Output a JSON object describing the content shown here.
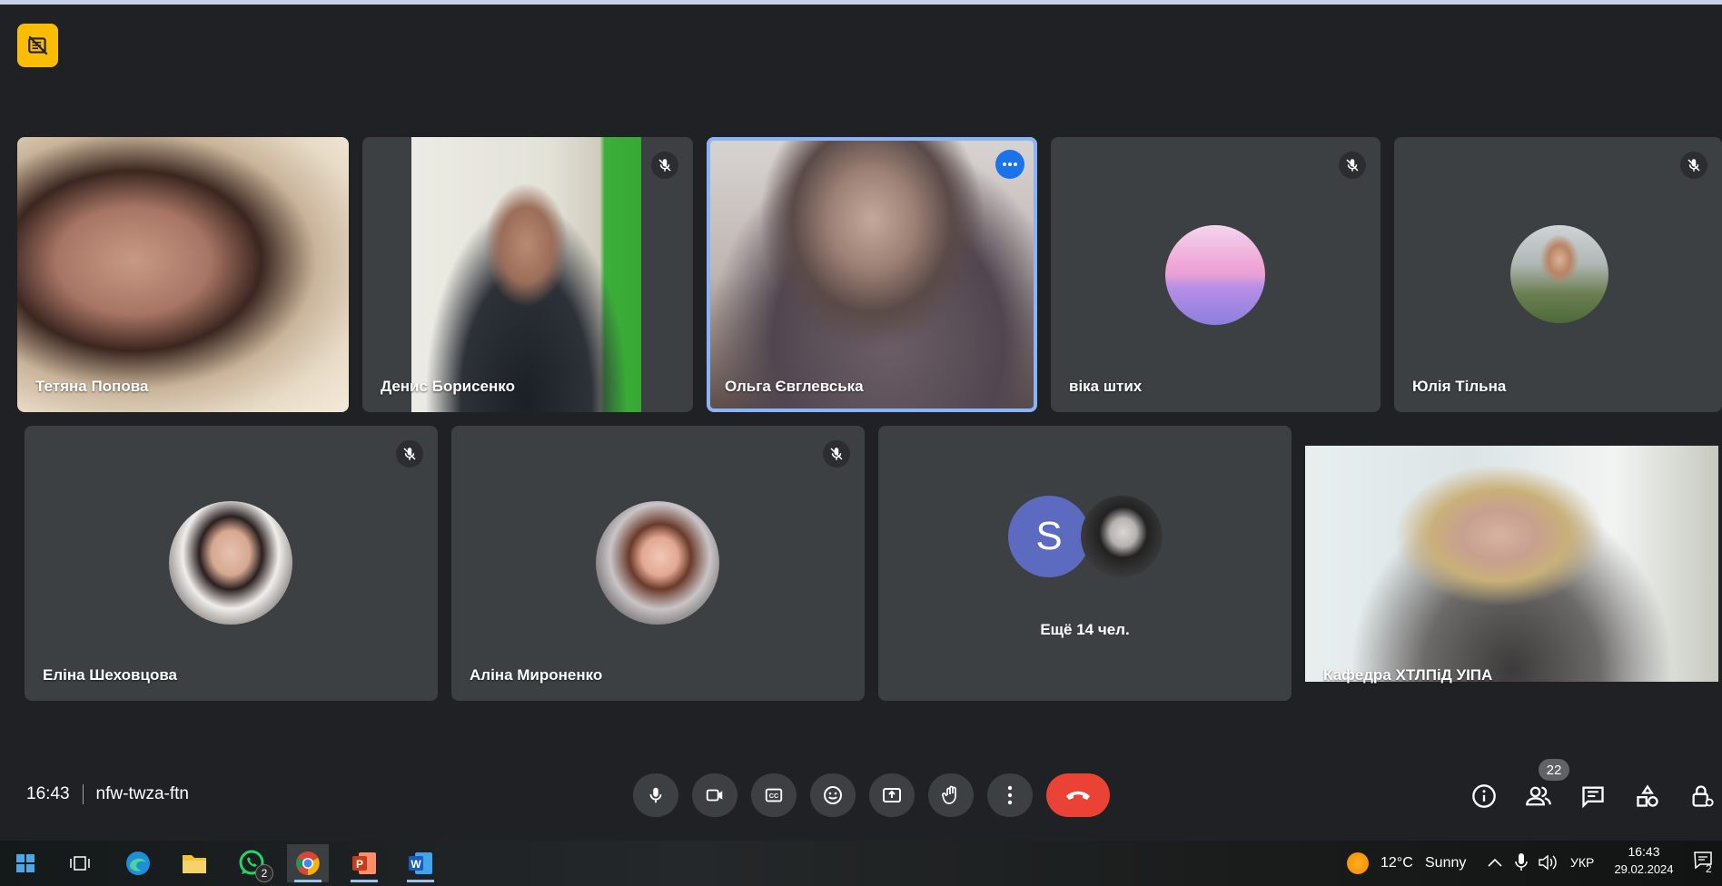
{
  "participants_row1": [
    {
      "name": "Тетяна Попова",
      "muted": false
    },
    {
      "name": "Денис Борисенко",
      "muted": true
    },
    {
      "name": "Ольга Євглевська",
      "muted": false,
      "speaking": true
    },
    {
      "name": "віка штих",
      "muted": true
    },
    {
      "name": "Юлія Тільна",
      "muted": true
    }
  ],
  "participants_row2": [
    {
      "name": "Еліна Шеховцова",
      "muted": true
    },
    {
      "name": "Аліна Мироненко",
      "muted": true
    },
    {
      "more_label": "Ещё 14 чел.",
      "avatar_letter": "S"
    },
    {
      "name": "Кафедра ХТЛПіД УІПА",
      "muted": false
    }
  ],
  "meeting": {
    "time": "16:43",
    "code": "nfw-twza-ftn"
  },
  "participants_count": "22",
  "controls": [
    "microphone-icon",
    "camera-icon",
    "captions-icon",
    "emoji-icon",
    "present-icon",
    "raise-hand-icon",
    "more-options-icon",
    "end-call-icon"
  ],
  "right_controls": [
    "info-icon",
    "people-icon",
    "chat-icon",
    "activities-icon",
    "host-controls-icon"
  ],
  "taskbar": {
    "apps": [
      "start-icon",
      "task-view-icon",
      "edge-icon",
      "file-explorer-icon",
      "whatsapp-icon",
      "chrome-icon",
      "powerpoint-icon",
      "word-icon"
    ],
    "whatsapp_badge": "2",
    "weather_temp": "12°C",
    "weather_text": "Sunny",
    "language": "УКР",
    "clock_time": "16:43",
    "clock_date": "29.02.2024",
    "notifications": "2"
  },
  "colors": {
    "background": "#202124",
    "tile": "#3c4043",
    "accent": "#8ab4f8",
    "hangup": "#ea4335",
    "badge": "#fbbc04"
  }
}
